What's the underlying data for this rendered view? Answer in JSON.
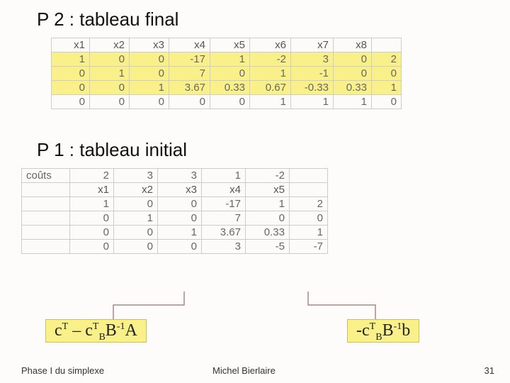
{
  "titles": {
    "t1": "P 2 : tableau final",
    "t2": "P 1 : tableau initial"
  },
  "table1": {
    "head": [
      "x1",
      "x2",
      "x3",
      "x4",
      "x5",
      "x6",
      "x7",
      "x8",
      ""
    ],
    "rows": [
      [
        "1",
        "0",
        "0",
        "-17",
        "1",
        "-2",
        "3",
        "0",
        "2"
      ],
      [
        "0",
        "1",
        "0",
        "7",
        "0",
        "1",
        "-1",
        "0",
        "0"
      ],
      [
        "0",
        "0",
        "1",
        "3.67",
        "0.33",
        "0.67",
        "-0.33",
        "0.33",
        "1"
      ],
      [
        "0",
        "0",
        "0",
        "0",
        "0",
        "1",
        "1",
        "1",
        "0"
      ]
    ]
  },
  "table2": {
    "label": "coûts",
    "costs": [
      "2",
      "3",
      "3",
      "1",
      "-2",
      ""
    ],
    "head": [
      "x1",
      "x2",
      "x3",
      "x4",
      "x5",
      ""
    ],
    "rows": [
      [
        "1",
        "0",
        "0",
        "-17",
        "1",
        "2"
      ],
      [
        "0",
        "1",
        "0",
        "7",
        "0",
        "0"
      ],
      [
        "0",
        "0",
        "1",
        "3.67",
        "0.33",
        "1"
      ],
      [
        "0",
        "0",
        "0",
        "3",
        "-5",
        "-7"
      ]
    ]
  },
  "formulas": {
    "left_html": "c<sup>T</sup> – c<sup>T</sup><sub>B</sub>B<sup>-1</sup>A",
    "right_html": "-c<sup>T</sup><sub>B</sub>B<sup>-1</sup>b"
  },
  "footer": {
    "left": "Phase I du simplexe",
    "center": "Michel Bierlaire",
    "right": "31"
  }
}
